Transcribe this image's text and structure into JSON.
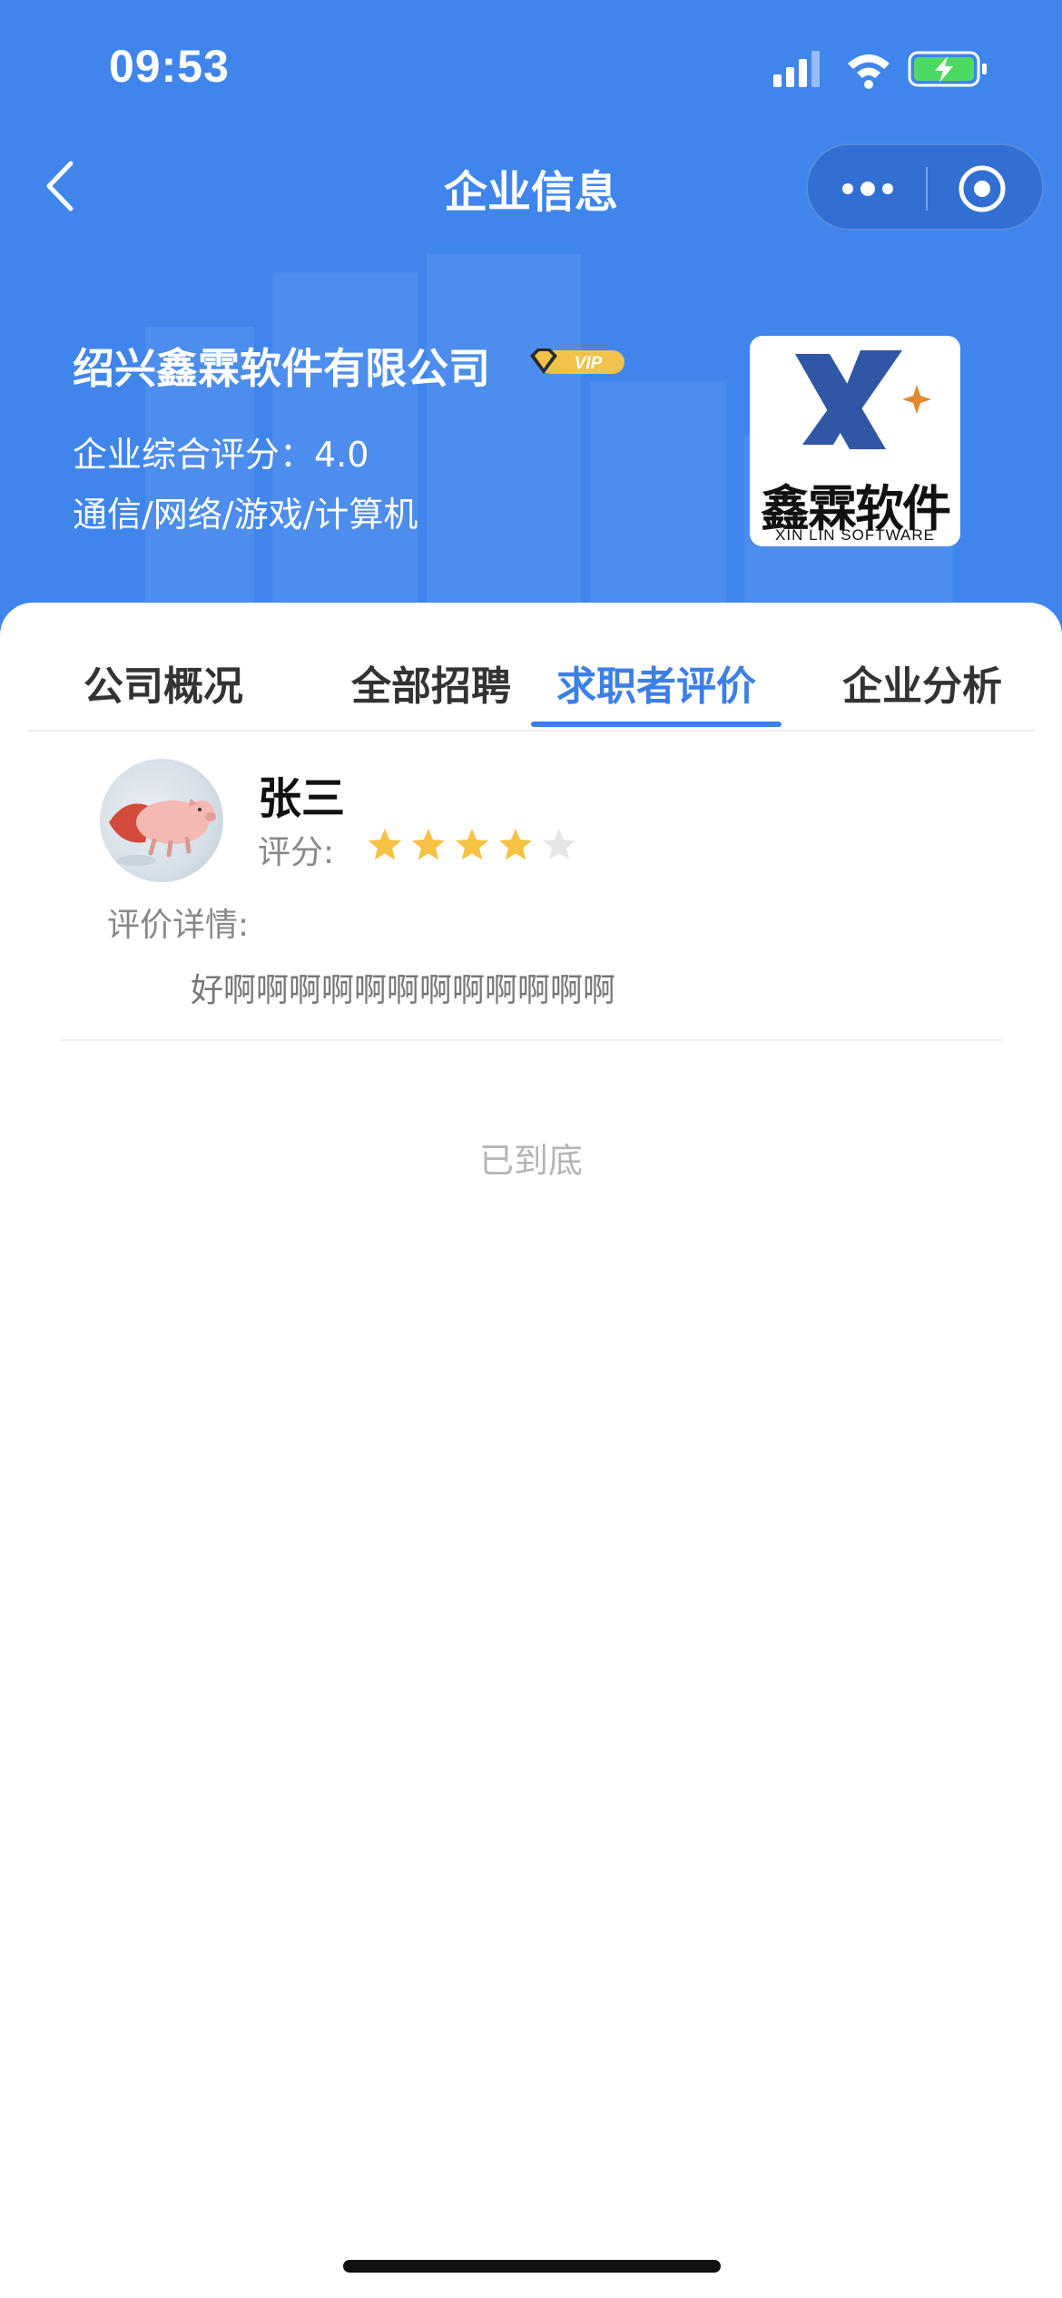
{
  "status_bar": {
    "time": "09:53"
  },
  "nav": {
    "title": "企业信息"
  },
  "company": {
    "name": "绍兴鑫霖软件有限公司",
    "vip_label": "VIP",
    "score_text": "企业综合评分：4.0",
    "industry": "通信/网络/游戏/计算机",
    "logo_cn": "鑫霖软件",
    "logo_en": "XIN LIN SOFTWARE"
  },
  "tabs": [
    {
      "label": "公司概况"
    },
    {
      "label": "全部招聘"
    },
    {
      "label": "求职者评价"
    },
    {
      "label": "企业分析"
    }
  ],
  "active_tab": "求职者评价",
  "review": {
    "name": "张三",
    "rating_label": "评分:",
    "rating": 4,
    "rating_max": 5,
    "detail_label": "评价详情:",
    "detail_text": "好啊啊啊啊啊啊啊啊啊啊啊啊"
  },
  "end_text": "已到底",
  "colors": {
    "header_bg": "#3f85ec",
    "accent": "#3c7fe6",
    "star_on": "#f7c144",
    "star_off": "#e6e6e6",
    "vip_gold": "#f1c34b"
  },
  "icons": [
    "back-chevron-icon",
    "more-dots-icon",
    "close-circle-icon",
    "signal-icon",
    "wifi-icon",
    "battery-charging-icon",
    "star-icon",
    "diamond-icon"
  ]
}
